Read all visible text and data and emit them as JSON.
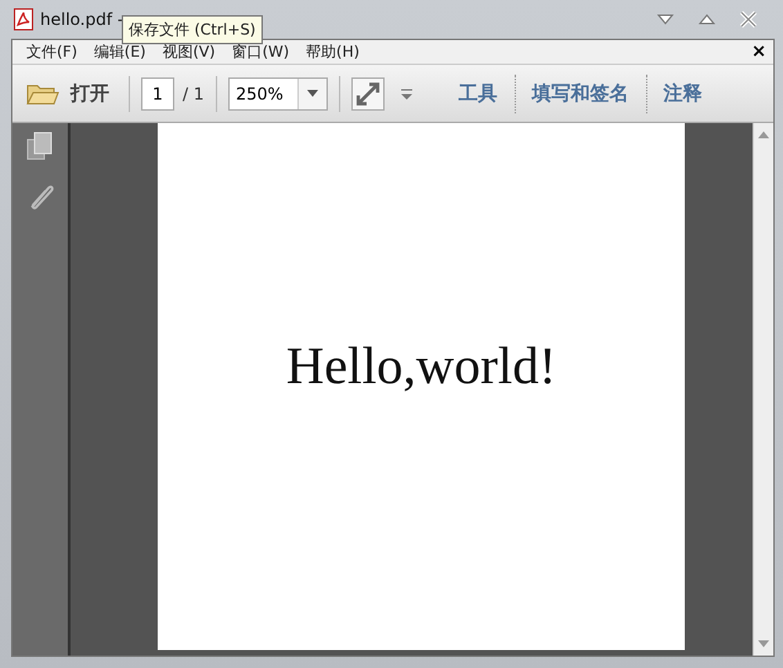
{
  "window": {
    "title": "hello.pdf -"
  },
  "tooltip": {
    "text": "保存文件 (Ctrl+S)"
  },
  "menu": {
    "items": [
      "文件(F)",
      "编辑(E)",
      "视图(V)",
      "窗口(W)",
      "帮助(H)"
    ],
    "close": "×"
  },
  "toolbar": {
    "open": "打开",
    "page": "1",
    "page_total": "/ 1",
    "zoom": "250%",
    "links": [
      "工具",
      "填写和签名",
      "注释"
    ]
  },
  "document": {
    "text": "Hello,world!"
  }
}
